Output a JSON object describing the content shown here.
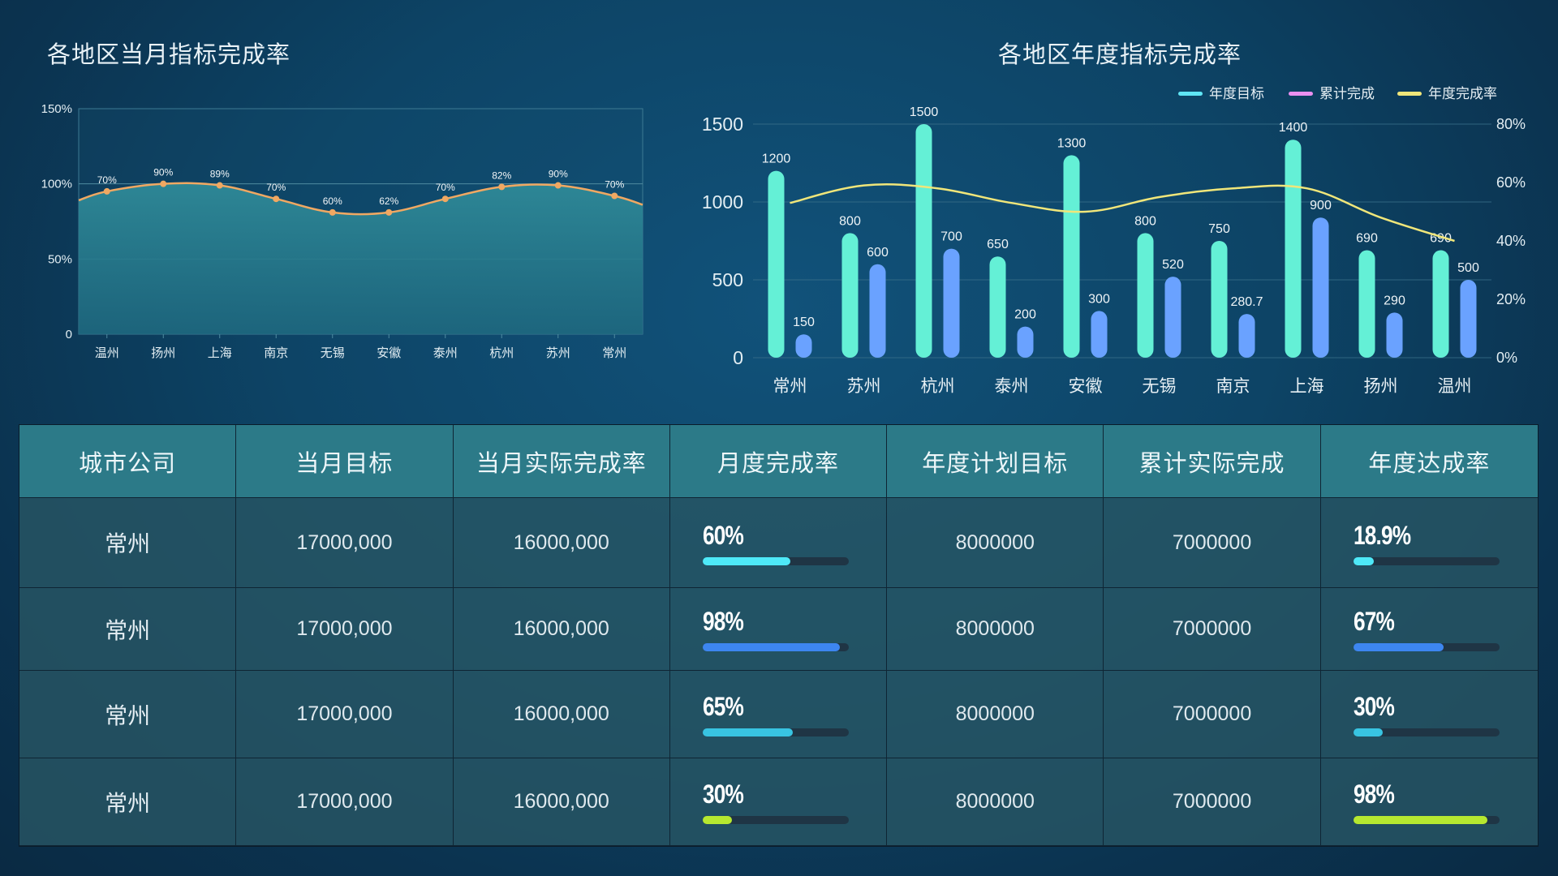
{
  "left_title": "各地区当月指标完成率",
  "right_title": "各地区年度指标完成率",
  "chart_data": [
    {
      "type": "area",
      "title": "各地区当月指标完成率",
      "categories": [
        "温州",
        "扬州",
        "上海",
        "南京",
        "无锡",
        "安徽",
        "泰州",
        "杭州",
        "苏州",
        "常州"
      ],
      "values": [
        0.95,
        1.0,
        0.99,
        0.9,
        0.81,
        0.81,
        0.9,
        0.98,
        0.99,
        0.92
      ],
      "point_labels": [
        "70%",
        "90%",
        "89%",
        "70%",
        "60%",
        "62%",
        "70%",
        "82%",
        "90%",
        "70%"
      ],
      "y_ticks": [
        "0",
        "50%",
        "100%",
        "150%"
      ],
      "ylim": [
        0,
        1.5
      ],
      "colors": {
        "line": "#f0a862",
        "fill": "#2a7c8c"
      }
    },
    {
      "type": "bar",
      "title": "各地区年度指标完成率",
      "categories": [
        "常州",
        "苏州",
        "杭州",
        "泰州",
        "安徽",
        "无锡",
        "南京",
        "上海",
        "扬州",
        "温州"
      ],
      "series": [
        {
          "name": "年度目标",
          "values": [
            1200,
            800,
            1500,
            650,
            1300,
            800,
            750,
            1400,
            690,
            690
          ],
          "labels": [
            "1200",
            "800",
            "1500",
            "650",
            "1300",
            "800",
            "750",
            "1400",
            "690",
            "690"
          ],
          "color": "#64f0d6"
        },
        {
          "name": "累计完成",
          "values": [
            150,
            600,
            700,
            200,
            300,
            520,
            280.7,
            900,
            290,
            500
          ],
          "labels": [
            "150",
            "600",
            "700",
            "200",
            "300",
            "520",
            "280.7",
            "900",
            "290",
            "500"
          ],
          "color": "#6aa2ff"
        },
        {
          "name": "年度完成率",
          "type": "line",
          "values": [
            53,
            59,
            58,
            53,
            50,
            55,
            58,
            58,
            48,
            40
          ],
          "color": "#f0e67a"
        }
      ],
      "legend_colors": [
        "#5fe6f5",
        "#ea8ff0",
        "#f0e67a"
      ],
      "y_left_ticks": [
        "0",
        "500",
        "1000",
        "1500"
      ],
      "ylim_left": [
        0,
        1500
      ],
      "y_right_ticks": [
        "0%",
        "20%",
        "40%",
        "60%",
        "80%"
      ],
      "ylim_right": [
        0,
        80
      ],
      "legend_position": "top-right"
    }
  ],
  "table": {
    "headers": [
      "城市公司",
      "当月目标",
      "当月实际完成率",
      "月度完成率",
      "年度计划目标",
      "累计实际完成",
      "年度达成率"
    ],
    "rows": [
      {
        "city": "常州",
        "target": "17000,000",
        "actual": "16000,000",
        "monthly": "60%",
        "monthly_value": 0.6,
        "monthly_color": "#4ee9f8",
        "plan": "8000000",
        "cumulative": "7000000",
        "annual": "18.9%",
        "annual_value": 0.14,
        "annual_color": "#4ee9f8"
      },
      {
        "city": "常州",
        "target": "17000,000",
        "actual": "16000,000",
        "monthly": "98%",
        "monthly_value": 0.94,
        "monthly_color": "#3d86f0",
        "plan": "8000000",
        "cumulative": "7000000",
        "annual": "67%",
        "annual_value": 0.62,
        "annual_color": "#3d86f0"
      },
      {
        "city": "常州",
        "target": "17000,000",
        "actual": "16000,000",
        "monthly": "65%",
        "monthly_value": 0.62,
        "monthly_color": "#38c4e2",
        "plan": "8000000",
        "cumulative": "7000000",
        "annual": "30%",
        "annual_value": 0.2,
        "annual_color": "#38c4e2"
      },
      {
        "city": "常州",
        "target": "17000,000",
        "actual": "16000,000",
        "monthly": "30%",
        "monthly_value": 0.2,
        "monthly_color": "#b6e830",
        "plan": "8000000",
        "cumulative": "7000000",
        "annual": "98%",
        "annual_value": 0.92,
        "annual_color": "#b6e830"
      }
    ]
  }
}
